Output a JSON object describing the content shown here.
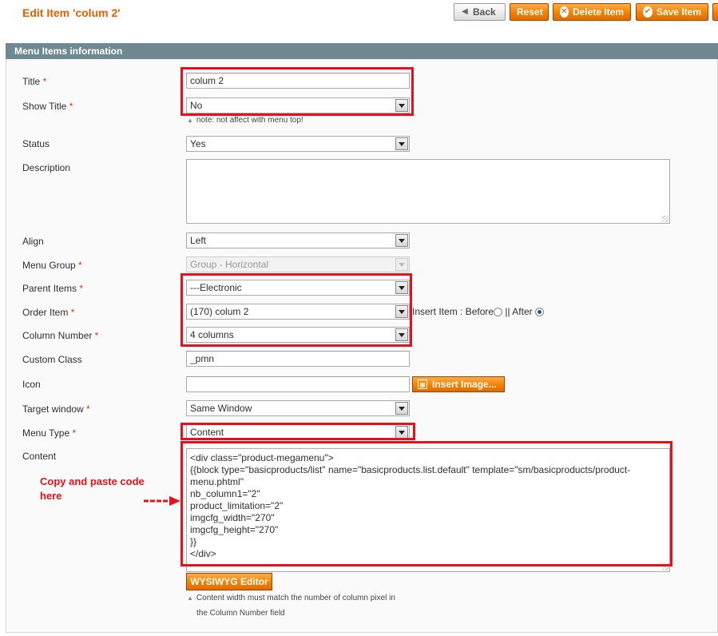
{
  "header": {
    "title": "Edit Item 'colum 2'",
    "buttons": {
      "back": "Back",
      "reset": "Reset",
      "delete": "Delete Item",
      "save": "Save Item"
    }
  },
  "section": {
    "title": "Menu Items information"
  },
  "fields": {
    "title": {
      "label": "Title",
      "value": "colum 2"
    },
    "show_title": {
      "label": "Show Title",
      "value": "No",
      "note": "note: not affect with menu top!"
    },
    "status": {
      "label": "Status",
      "value": "Yes"
    },
    "description": {
      "label": "Description",
      "value": ""
    },
    "align": {
      "label": "Align",
      "value": "Left"
    },
    "menu_group": {
      "label": "Menu Group",
      "value": "Group - Horizontal"
    },
    "parent_items": {
      "label": "Parent Items",
      "value": "---Electronic"
    },
    "order_item": {
      "label": "Order Item",
      "value": "(170) colum 2"
    },
    "insert_item": {
      "label": "Insert Item : Before",
      "separator": "|| After",
      "selected": "After"
    },
    "column_number": {
      "label": "Column Number",
      "value": "4 columns"
    },
    "custom_class": {
      "label": "Custom Class",
      "value": "_pmn"
    },
    "icon": {
      "label": "Icon",
      "value": "",
      "button": "Insert Image..."
    },
    "target_window": {
      "label": "Target window",
      "value": "Same Window"
    },
    "menu_type": {
      "label": "Menu Type",
      "value": "Content"
    },
    "content": {
      "label": "Content",
      "lines": [
        "<div class=\"product-megamenu\">",
        "{{block type=\"basicproducts/list\" name=\"basicproducts.list.default\" template=\"sm/basicproducts/product-",
        "menu.phtml\"",
        "nb_column1=\"2\"",
        "product_limitation=\"2\"",
        "imgcfg_width=\"270\"",
        "imgcfg_height=\"270\"",
        "}}",
        "</div>"
      ],
      "editor_button": "WYSIWYG Editor",
      "note_line1": "Content width must match the number of column pixel in",
      "note_line2": "the Column Number field"
    }
  },
  "annotation": {
    "line1": "Copy and paste code",
    "line2": "here"
  },
  "required_mark": "*",
  "colors": {
    "accent": "#eb5e00",
    "button_orange": "#f18200",
    "section_header": "#6f8992",
    "highlight_red": "#e8101b"
  }
}
